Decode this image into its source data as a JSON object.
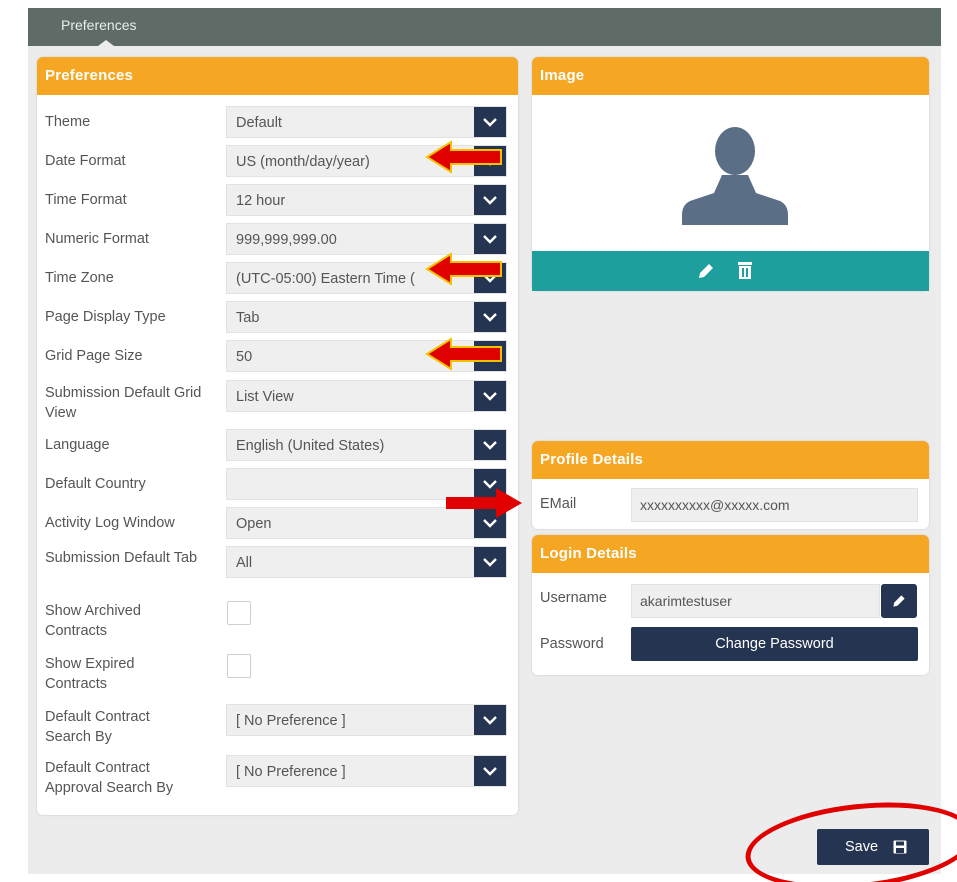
{
  "tab": {
    "label": "Preferences"
  },
  "preferences": {
    "title": "Preferences",
    "fields": [
      {
        "label": "Theme",
        "value": "Default"
      },
      {
        "label": "Date Format",
        "value": "US (month/day/year)"
      },
      {
        "label": "Time Format",
        "value": "12 hour"
      },
      {
        "label": "Numeric Format",
        "value": "999,999,999.00"
      },
      {
        "label": "Time Zone",
        "value": "(UTC-05:00) Eastern Time ("
      },
      {
        "label": "Page Display Type",
        "value": "Tab"
      },
      {
        "label": "Grid Page Size",
        "value": "50"
      },
      {
        "label": "Submission Default Grid View",
        "value": "List View"
      },
      {
        "label": "Language",
        "value": "English (United States)"
      },
      {
        "label": "Default Country",
        "value": ""
      },
      {
        "label": "Activity Log Window",
        "value": "Open"
      },
      {
        "label": "Submission Default Tab",
        "value": "All"
      },
      {
        "label": "Show Archived Contracts",
        "checked": false
      },
      {
        "label": "Show Expired Contracts",
        "checked": false
      },
      {
        "label": "Default Contract Search By",
        "value": "[ No Preference ]"
      },
      {
        "label": "Default Contract Approval Search By",
        "value": "[ No Preference ]"
      }
    ]
  },
  "image": {
    "title": "Image",
    "icons": [
      "user-silhouette-icon",
      "pencil-icon",
      "trash-icon"
    ]
  },
  "profile": {
    "title": "Profile Details",
    "email_label": "EMail",
    "email_value": "xxxxxxxxxx@xxxxx.com"
  },
  "login": {
    "title": "Login Details",
    "username_label": "Username",
    "username_value": "akarimtestuser",
    "password_label": "Password",
    "change_password_label": "Change Password"
  },
  "actions": {
    "save_label": "Save"
  },
  "annotations": {
    "arrow_color": "#e00000",
    "arrow_outline": "#f2c200",
    "circle_color": "#e00000"
  },
  "colors": {
    "header_orange": "#f5a623",
    "navy": "#253551",
    "teal": "#1e9e9c",
    "topbar": "#5f6b66"
  }
}
